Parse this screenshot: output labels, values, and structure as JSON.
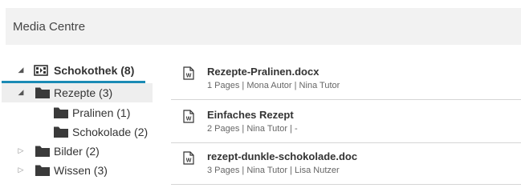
{
  "header": {
    "title": "Media Centre"
  },
  "tree": {
    "root": {
      "label": "Schokothek (8)",
      "toggle": "◢",
      "icon": "media-collection-icon"
    },
    "items": [
      {
        "label": "Rezepte (3)",
        "toggle": "◢",
        "icon": "folder-icon"
      },
      {
        "label": "Pralinen (1)",
        "toggle": "",
        "icon": "folder-icon"
      },
      {
        "label": "Schokolade (2)",
        "toggle": "",
        "icon": "folder-icon"
      },
      {
        "label": "Bilder (2)",
        "toggle": "▷",
        "icon": "folder-icon"
      },
      {
        "label": "Wissen (3)",
        "toggle": "▷",
        "icon": "folder-icon"
      }
    ]
  },
  "documents": [
    {
      "title": "Rezepte-Pralinen.docx",
      "meta": "1 Pages | Mona Autor | Nina Tutor",
      "icon": "word-document-icon"
    },
    {
      "title": "Einfaches Rezept",
      "meta": "2 Pages | Nina Tutor | -",
      "icon": "word-document-icon"
    },
    {
      "title": "rezept-dunkle-schokolade.doc",
      "meta": "3 Pages | Nina Tutor | Lisa Nutzer",
      "icon": "word-document-icon"
    }
  ],
  "colors": {
    "accent": "#1b8bb5",
    "header_bg": "#f2f2f2",
    "folder": "#3a3a3a"
  }
}
